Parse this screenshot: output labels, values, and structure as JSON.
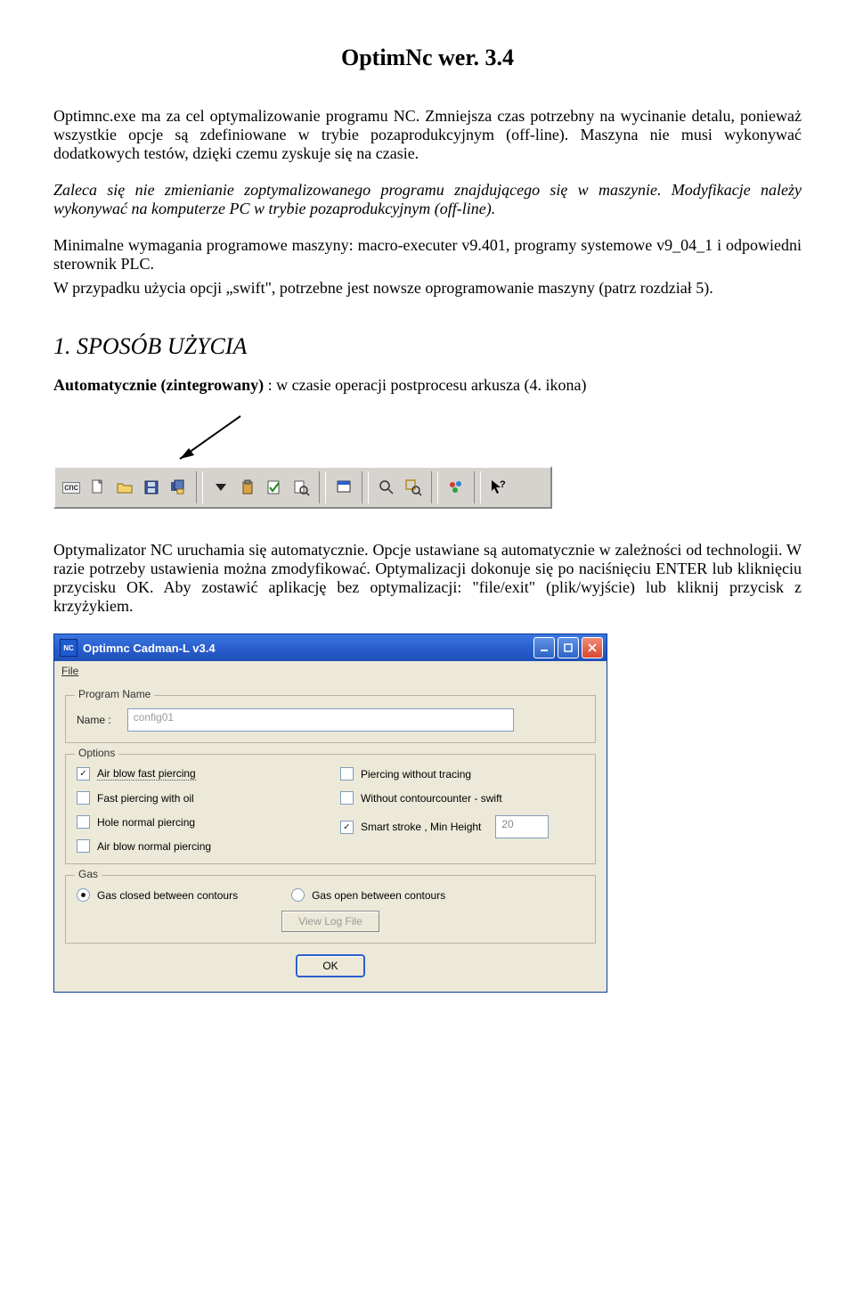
{
  "page": {
    "title": "OptimNc wer. 3.4"
  },
  "para1": "Optimnc.exe ma za cel optymalizowanie programu NC. Zmniejsza czas potrzebny na wycinanie detalu, ponieważ wszystkie opcje są zdefiniowane w trybie pozaprodukcyjnym (off-line). Maszyna nie musi wykonywać dodatkowych testów, dzięki czemu zyskuje się na czasie.",
  "para2": "Zaleca się nie zmienianie zoptymalizowanego programu znajdującego się w maszynie. Modyfikacje należy wykonywać na komputerze PC w trybie pozaprodukcyjnym (off-line).",
  "para3": "Minimalne wymagania programowe maszyny: macro-executer v9.401, programy systemowe v9_04_1 i odpowiedni sterownik PLC.",
  "para4": "W przypadku użycia opcji „swift\", potrzebne jest nowsze oprogramowanie maszyny (patrz rozdział 5).",
  "section1": {
    "heading": "1. SPOSÓB UŻYCIA",
    "line_bold": "Automatycznie (zintegrowany)",
    "line_rest": " : w czasie operacji postprocesu arkusza (4. ikona)"
  },
  "toolbar": {
    "cnc_label": "cnc"
  },
  "para5": "Optymalizator NC uruchamia się automatycznie. Opcje ustawiane są automatycznie w zależności od technologii. W razie potrzeby ustawienia można zmodyfikować. Optymalizacji dokonuje się po naciśnięciu ENTER lub kliknięciu przycisku OK. Aby zostawić aplikację bez optymalizacji: \"file/exit\" (plik/wyjście) lub kliknij przycisk z krzyżykiem.",
  "window": {
    "title": "Optimnc Cadman-L v3.4",
    "icon_text": "NC",
    "menu_file": "File",
    "group_program": {
      "legend": "Program Name",
      "name_label": "Name :",
      "name_value": "config01"
    },
    "group_options": {
      "legend": "Options",
      "left": [
        {
          "label": "Air blow fast piercing",
          "checked": true
        },
        {
          "label": "Fast piercing with oil",
          "checked": false
        },
        {
          "label": "Hole normal piercing",
          "checked": false
        },
        {
          "label": "Air blow normal piercing",
          "checked": false
        }
      ],
      "right": [
        {
          "label": "Piercing without tracing",
          "checked": false
        },
        {
          "label": "Without contourcounter - swift",
          "checked": false
        }
      ],
      "smart_stroke": {
        "label": "Smart stroke ,   Min Height",
        "checked": true,
        "value": "20"
      }
    },
    "group_gas": {
      "legend": "Gas",
      "closed": {
        "label": "Gas closed between contours",
        "selected": true
      },
      "open": {
        "label": "Gas open between contours",
        "selected": false
      },
      "view_log": "View Log File"
    },
    "ok": "OK"
  }
}
